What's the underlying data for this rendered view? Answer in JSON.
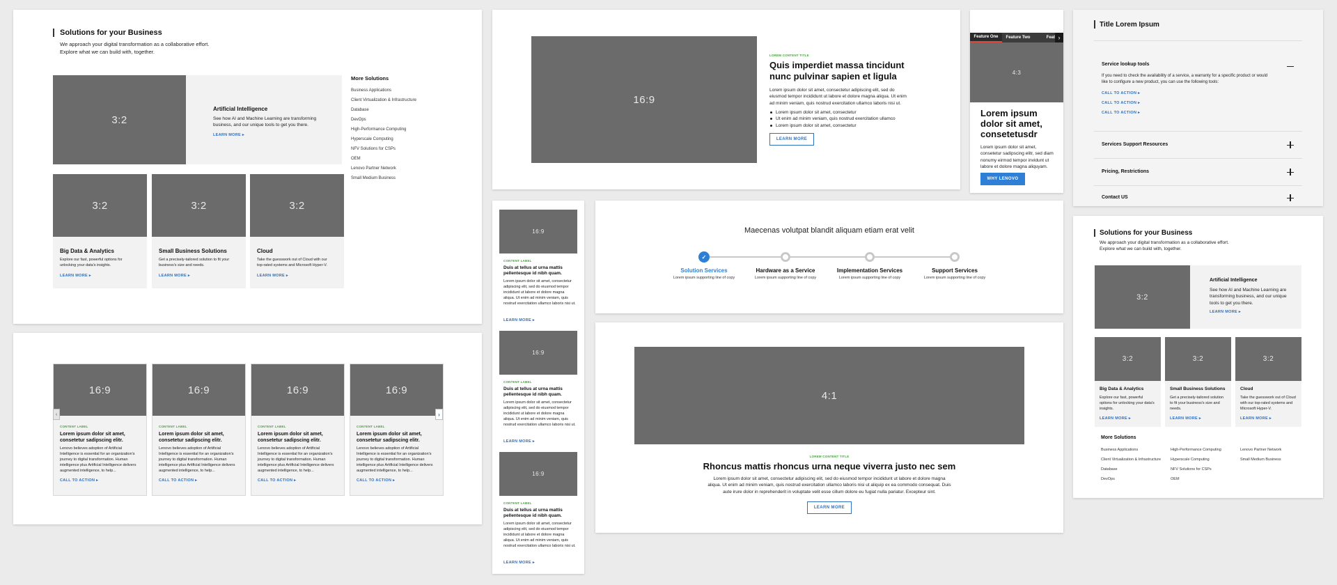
{
  "colors": {
    "accent": "#2f6fbf",
    "label_green": "#3fa535",
    "placeholder": "#6b6b6b",
    "page_bg": "#ebebeb"
  },
  "p1": {
    "title": "Solutions for your Business",
    "subtitle_1": "We approach your digital transformation as a collaborative effort.",
    "subtitle_2": "Explore what we can build with, together.",
    "hero": {
      "ratio": "3:2",
      "title": "Artificial Intelligence",
      "text": "See how AI and Machine Learning are transforming business, and our unique tools to get you there.",
      "link": "LEARN MORE"
    },
    "tiles": [
      {
        "ratio": "3:2",
        "title": "Big Data & Analytics",
        "text": "Explore our fast, powerful options for unlocking your data's insights.",
        "link": "LEARN MORE"
      },
      {
        "ratio": "3:2",
        "title": "Small Business Solutions",
        "text": "Get a precisely-tailored solution to fit your business's size and needs.",
        "link": "LEARN MORE"
      },
      {
        "ratio": "3:2",
        "title": "Cloud",
        "text": "Take the guesswork out of Cloud with our top-rated systems and Microsoft Hyper-V.",
        "link": "LEARN MORE"
      }
    ],
    "more_title": "More Solutions",
    "more": [
      "Business Applications",
      "Client Virtualization & Infrastructure",
      "Database",
      "DevOps",
      "High-Performance Computing",
      "Hyperscale Computing",
      "NFV Solutions for CSPs",
      "OEM",
      "Lenovo Partner Network",
      "Small Medium Business"
    ]
  },
  "p2": {
    "cards": [
      {
        "ratio": "16:9",
        "label": "CONTENT LABEL",
        "title": "Lorem ipsum dolor sit amet, consetetur sadipscing elitr.",
        "text": "Lenovo believes adoption of Artificial Intelligence is essential for an organization's journey to digital transformation. Human intelligence plus Artificial Intelligence delivers augmented intelligence, to help...",
        "link": "CALL TO ACTION"
      },
      {
        "ratio": "16:9",
        "label": "CONTENT LABEL",
        "title": "Lorem ipsum dolor sit amet, consetetur sadipscing elitr.",
        "text": "Lenovo believes adoption of Artificial Intelligence is essential for an organization's journey to digital transformation. Human intelligence plus Artificial Intelligence delivers augmented intelligence, to help...",
        "link": "CALL TO ACTION"
      },
      {
        "ratio": "16:9",
        "label": "CONTENT LABEL",
        "title": "Lorem ipsum dolor sit amet, consetetur sadipscing elitr.",
        "text": "Lenovo believes adoption of Artificial Intelligence is essential for an organization's journey to digital transformation. Human intelligence plus Artificial Intelligence delivers augmented intelligence, to help...",
        "link": "CALL TO ACTION"
      },
      {
        "ratio": "16:9",
        "label": "CONTENT LABEL",
        "title": "Lorem ipsum dolor sit amet, consetetur sadipscing elitr.",
        "text": "Lenovo believes adoption of Artificial Intelligence is essential for an organization's journey to digital transformation. Human intelligence plus Artificial Intelligence delivers augmented intelligence, to help...",
        "link": "CALL TO ACTION"
      }
    ]
  },
  "p3": {
    "ratio": "16:9",
    "label": "LOREM CONTENT TITLE",
    "title": "Quis imperdiet massa tincidunt nunc pulvinar sapien et ligula",
    "text": "Lorem ipsum dolor sit amet, consectetur adipiscing elit, sed do eiusmod tempor incididunt ut labore et dolore magna aliqua. Ut enim ad minim veniam, quis nostrud exercitation ullamco laboris nisi ut.",
    "bullets": [
      "Lorem ipsum dolor sit amet, consectetur",
      "Ut enim ad minim veniam, quis nostrud exercitation ullamco",
      "Lorem ipsum dolor sit amet, consectetur"
    ],
    "button": "LEARN MORE"
  },
  "p4": {
    "tabs": [
      "Feature One",
      "Feature Two",
      "Feat"
    ],
    "ratio": "4:3",
    "title": "Lorem ipsum dolor sit amet, consetetusdr",
    "text": "Lorem ipsum dolor sit amet, consetetur sadipscing elitr, sed diam nonumy eirmod tempor invidunt ut labore et dolore magna aliquyam.",
    "button": "WHY LENOVO"
  },
  "p5": {
    "title": "Title Lorem Ipsum",
    "open": {
      "title": "Service lookup tools",
      "text": "If you need to check the availability of a service, a warranty for a specific product or would like to configure a new product, you can use the following tools:",
      "links": [
        "CALL TO ACTION",
        "CALL TO ACTION",
        "CALL TO ACTION"
      ]
    },
    "closed": [
      "Services Support Resources",
      "Pricing, Restrictions",
      "Contact US"
    ]
  },
  "p6": {
    "cards": [
      {
        "ratio": "16:9",
        "label": "CONTENT LABEL",
        "title": "Duis at tellus at urna mattis pellentesque id nibh quam.",
        "text": "Lorem ipsum dolor sit amet, consectetur adipiscing elit, sed do eiusmod tempor incididunt ut labore et dolore magna aliqua. Ut enim ad minim veniam, quis nostrud exercitation ullamco laboris nisi ut.",
        "link": "LEARN MORE"
      },
      {
        "ratio": "16:9",
        "label": "CONTENT LABEL",
        "title": "Duis at tellus at urna mattis pellentesque id nibh quam.",
        "text": "Lorem ipsum dolor sit amet, consectetur adipiscing elit, sed do eiusmod tempor incididunt ut labore et dolore magna aliqua. Ut enim ad minim veniam, quis nostrud exercitation ullamco laboris nisi ut.",
        "link": "LEARN MORE"
      },
      {
        "ratio": "16:9",
        "label": "CONTENT LABEL",
        "title": "Duis at tellus at urna mattis pellentesque id nibh quam.",
        "text": "Lorem ipsum dolor sit amet, consectetur adipiscing elit, sed do eiusmod tempor incididunt ut labore et dolore magna aliqua. Ut enim ad minim veniam, quis nostrud exercitation ullamco laboris nisi ut.",
        "link": "LEARN MORE"
      }
    ]
  },
  "p7": {
    "title": "Maecenas volutpat blandit aliquam etiam erat velit",
    "steps": [
      {
        "title": "Solution Services",
        "sub": "Lorem ipsum supporting line of copy"
      },
      {
        "title": "Hardware as a Service",
        "sub": "Lorem ipsum supporting line of copy"
      },
      {
        "title": "Implementation Services",
        "sub": "Lorem ipsum supporting line of copy"
      },
      {
        "title": "Support Services",
        "sub": "Lorem ipsum supporting line of copy"
      }
    ]
  },
  "p8": {
    "ratio": "4:1",
    "label": "LOREM CONTENT TITLE",
    "title": "Rhoncus mattis rhoncus urna neque viverra justo nec sem",
    "text": "Lorem ipsum dolor sit amet, consectetur adipiscing elit, sed do eiusmod tempor incididunt ut labore et dolore magna aliqua. Ut enim ad minim veniam, quis nostrud exercitation ullamco laboris nisi ut aliquip ex ea commodo consequat. Duis aute irure dolor in reprehenderit in voluptate velit esse cillum dolore eu fugiat nulla pariatur. Excepteur sint.",
    "button": "LEARN MORE"
  },
  "p9": {
    "title": "Solutions for your Business",
    "subtitle": "We approach your digital transformation as a collaborative effort. Explore what we can build with, together.",
    "hero": {
      "ratio": "3:2",
      "title": "Artificial Intelligence",
      "text": "See how AI and Machine Learning are transforming business, and our unique tools to get you there.",
      "link": "LEARN MORE"
    },
    "tiles": [
      {
        "ratio": "3:2",
        "title": "Big Data & Analytics",
        "text": "Explore our fast, powerful options for unlocking your data's insights.",
        "link": "LEARN MORE"
      },
      {
        "ratio": "3:2",
        "title": "Small Business Solutions",
        "text": "Get a precisely-tailored solution to fit your business's size and needs.",
        "link": "LEARN MORE"
      },
      {
        "ratio": "3:2",
        "title": "Cloud",
        "text": "Take the guesswork out of Cloud with our top-rated systems and Microsoft Hyper-V.",
        "link": "LEARN MORE"
      }
    ],
    "more_title": "More Solutions",
    "more": [
      "Business Applications",
      "Client Virtualization & Infrastructure",
      "Database",
      "DevOps",
      "High-Performance Computing",
      "Hyperscale Computing",
      "NFV Solutions for CSPs",
      "OEM",
      "Lenovo Partner Network",
      "Small Medium Business"
    ]
  }
}
